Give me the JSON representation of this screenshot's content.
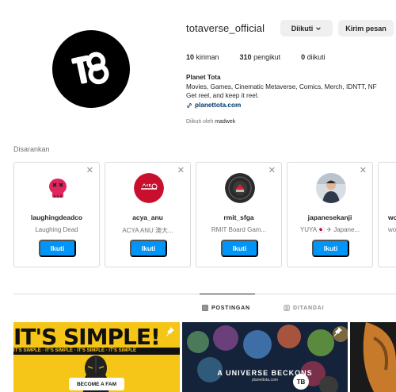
{
  "profile": {
    "username": "totaverse_official",
    "following_label": "Diikuti",
    "message_label": "Kirim pesan",
    "stats": [
      {
        "count": "10",
        "label": " kiriman"
      },
      {
        "count": "310",
        "label": " pengikut"
      },
      {
        "count": "0",
        "label": " diikuti"
      }
    ],
    "bio": {
      "name": "Planet Tota",
      "line1": "Movies, Games, Cinematic Metaverse, Comics, Merch, IDNTT, NF",
      "line2": "Get reel, and keep it reel.",
      "link": "planettota.com"
    },
    "followed_by_prefix": "Diikuti oleh ",
    "followed_by_user": "madwek"
  },
  "suggested": {
    "title": "Disarankan",
    "follow_label": "Ikuti",
    "cards": [
      {
        "username": "laughingdeadco",
        "subtitle": "Laughing Dead"
      },
      {
        "username": "acya_anu",
        "subtitle": "ACYA ANU 澳大..."
      },
      {
        "username": "rmit_sfga",
        "subtitle": "RMIT Board Gam..."
      },
      {
        "username": "japanesekanji",
        "subtitle": "YUYA🇯🇵 ✈ Japane..."
      },
      {
        "username": "wo",
        "subtitle": "wo"
      }
    ]
  },
  "tabs": {
    "posts": "POSTINGAN",
    "tagged": "DITANDAI"
  },
  "posts": {
    "post1_banner": "IT'S SIMPLE!",
    "post1_strip": "IT'S SIMPLE · IT'S SIMPLE · IT'S SIMPLE · IT'S SIMPLE",
    "post1_cta": "BECOME A FAM",
    "post2_headline": "A UNIVERSE BECKONS",
    "post2_url": "planettota.com"
  }
}
